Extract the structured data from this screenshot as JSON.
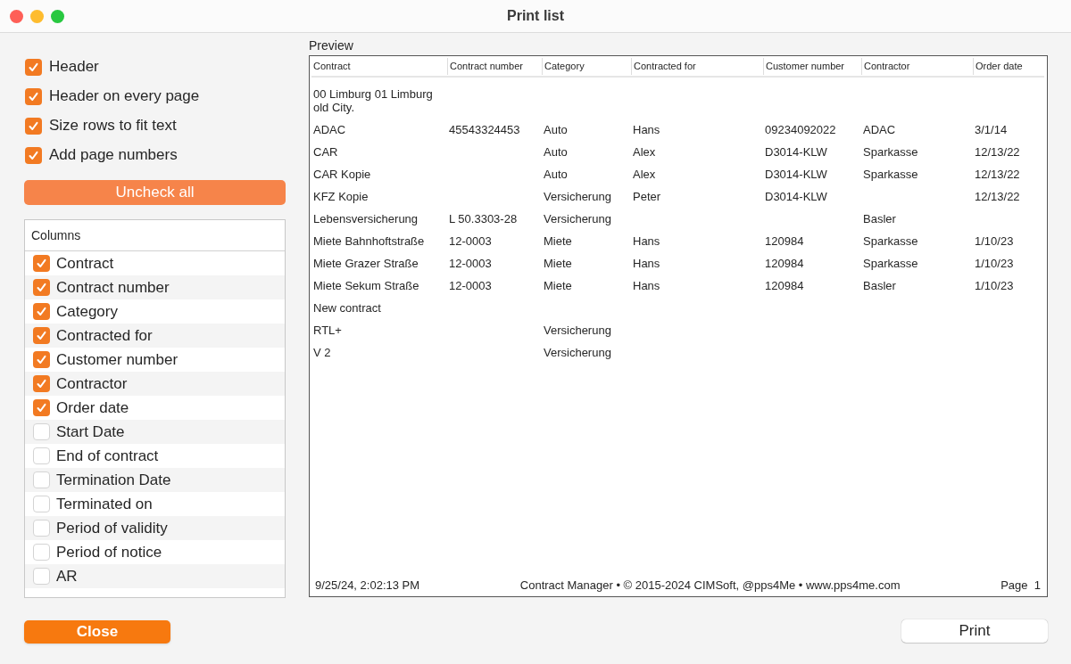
{
  "window": {
    "title": "Print list"
  },
  "options": [
    {
      "label": "Header",
      "checked": true
    },
    {
      "label": "Header on every page",
      "checked": true
    },
    {
      "label": "Size rows to fit text",
      "checked": true
    },
    {
      "label": "Add page numbers",
      "checked": true
    }
  ],
  "uncheck_all_button": "Uncheck all",
  "columns_list": {
    "header": "Columns",
    "items": [
      {
        "label": "Contract",
        "checked": true
      },
      {
        "label": "Contract number",
        "checked": true
      },
      {
        "label": "Category",
        "checked": true
      },
      {
        "label": "Contracted for",
        "checked": true
      },
      {
        "label": "Customer number",
        "checked": true
      },
      {
        "label": "Contractor",
        "checked": true
      },
      {
        "label": "Order date",
        "checked": true
      },
      {
        "label": "Start Date",
        "checked": false
      },
      {
        "label": "End of contract",
        "checked": false
      },
      {
        "label": "Termination Date",
        "checked": false
      },
      {
        "label": "Terminated on",
        "checked": false
      },
      {
        "label": "Period of validity",
        "checked": false
      },
      {
        "label": "Period of notice",
        "checked": false
      },
      {
        "label": "AR",
        "checked": false
      }
    ]
  },
  "close_button": "Close",
  "preview": {
    "label": "Preview",
    "table": {
      "columns": [
        "Contract",
        "Contract number",
        "Category",
        "Contracted for",
        "Customer number",
        "Contractor",
        "Order date"
      ],
      "rows": [
        [
          "00 Limburg 01 Limburg old City.",
          null,
          null,
          null,
          null,
          null,
          null
        ],
        [
          "ADAC",
          "45543324453",
          "Auto",
          "Hans",
          "09234092022",
          "ADAC",
          "3/1/14"
        ],
        [
          "CAR",
          null,
          "Auto",
          "Alex",
          "D3014-KLW",
          "Sparkasse",
          "12/13/22"
        ],
        [
          "CAR Kopie",
          null,
          "Auto",
          "Alex",
          "D3014-KLW",
          "Sparkasse",
          "12/13/22"
        ],
        [
          "KFZ Kopie",
          null,
          "Versicherung",
          "Peter",
          "D3014-KLW",
          null,
          "12/13/22"
        ],
        [
          "Lebensversicherung",
          "L 50.3303-28",
          "Versicherung",
          null,
          null,
          "Basler",
          null
        ],
        [
          "Miete Bahnhoftstraße",
          "12-0003",
          "Miete",
          "Hans",
          "120984",
          "Sparkasse",
          "1/10/23"
        ],
        [
          "Miete Grazer Straße",
          "12-0003",
          "Miete",
          "Hans",
          "120984",
          "Sparkasse",
          "1/10/23"
        ],
        [
          "Miete Sekum Straße",
          "12-0003",
          "Miete",
          "Hans",
          "120984",
          "Basler",
          "1/10/23"
        ],
        [
          "New contract",
          null,
          null,
          null,
          null,
          null,
          null
        ],
        [
          "RTL+",
          null,
          "Versicherung",
          null,
          null,
          null,
          null
        ],
        [
          "V 2",
          null,
          "Versicherung",
          null,
          null,
          null,
          null
        ]
      ]
    },
    "footer": {
      "timestamp": "9/25/24, 2:02:13 PM",
      "credits": "Contract Manager • © 2015-2024 CIMSoft, @pps4Me • www.pps4me.com",
      "page": "Page  1"
    }
  },
  "print_button": "Print"
}
